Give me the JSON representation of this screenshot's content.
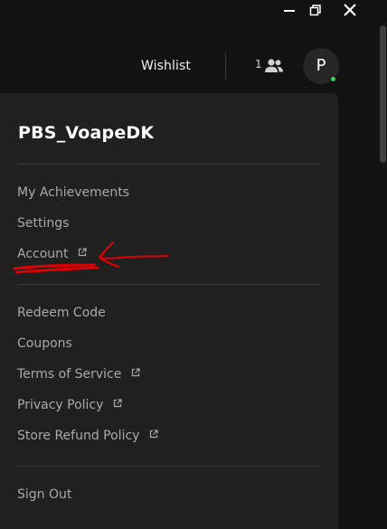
{
  "window_controls": {
    "minimize_icon": "minimize-icon",
    "restore_icon": "restore-icon",
    "close_icon": "close-icon"
  },
  "topbar": {
    "wishlist_label": "Wishlist",
    "friends_count": "1",
    "friends_icon": "friends-icon",
    "avatar_letter": "P",
    "online_status_color": "#44c767"
  },
  "menu": {
    "username": "PBS_VoapeDK",
    "group1": [
      {
        "label": "My Achievements",
        "external": false
      },
      {
        "label": "Settings",
        "external": false
      },
      {
        "label": "Account",
        "external": true
      }
    ],
    "group2": [
      {
        "label": "Redeem Code",
        "external": false
      },
      {
        "label": "Coupons",
        "external": false
      },
      {
        "label": "Terms of Service",
        "external": true
      },
      {
        "label": "Privacy Policy",
        "external": true
      },
      {
        "label": "Store Refund Policy",
        "external": true
      }
    ],
    "sign_out_label": "Sign Out"
  },
  "annotation": {
    "color": "#e00000",
    "shape": "red arrow pointing at Account with underline"
  }
}
